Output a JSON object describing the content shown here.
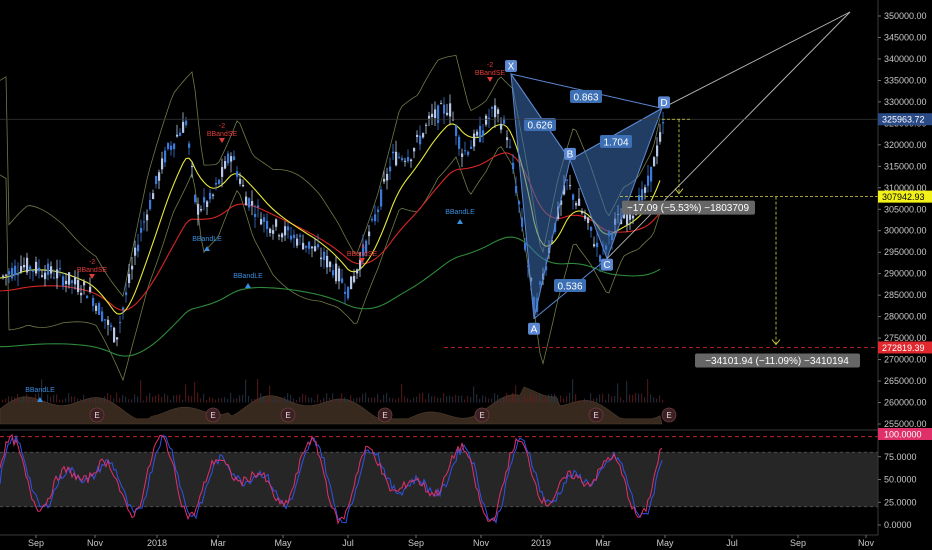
{
  "chart_data": [
    {
      "type": "candlestick",
      "price_ticks": [
        "350000.00",
        "345000.00",
        "340000.00",
        "335000.00",
        "330000.00",
        "325000.00",
        "320000.00",
        "315000.00",
        "310000.00",
        "305000.00",
        "300000.00",
        "295000.00",
        "290000.00",
        "285000.00",
        "280000.00",
        "275000.00",
        "270000.00",
        "265000.00",
        "260000.00",
        "255000.00"
      ],
      "ylim": [
        255000,
        350000
      ],
      "time_ticks": [
        "Sep",
        "Nov",
        "2018",
        "Mar",
        "May",
        "Jul",
        "Sep",
        "Nov",
        "2019",
        "Mar",
        "May",
        "Jul",
        "Sep",
        "Nov"
      ],
      "grid": false,
      "price_labels": [
        {
          "text": "325963.72",
          "value": 325963.72,
          "color": "#2a4a86"
        },
        {
          "text": "307942.93",
          "value": 307942.93,
          "color": "#f2f21a"
        },
        {
          "text": "272819.39",
          "value": 272819.39,
          "color": "#e0282e"
        }
      ],
      "harmonic_pattern": {
        "points": [
          {
            "label": "X",
            "value": 336500
          },
          {
            "label": "A",
            "value": 279500
          },
          {
            "label": "B",
            "value": 316500
          },
          {
            "label": "C",
            "value": 293500
          },
          {
            "label": "D",
            "value": 328500
          }
        ],
        "ratios": [
          "0.863",
          "0.626",
          "1.704",
          "0.536"
        ]
      },
      "measurements": [
        {
          "text": "−17.09 (−5.53%) −1803709",
          "from": 325963.72,
          "to": 307942.93
        },
        {
          "text": "−34101.94 (−11.09%) −3410194",
          "from": 307942.93,
          "to": 272819.39
        }
      ],
      "signals": [
        {
          "text": "BBandSE",
          "count": "-2",
          "kind": "sell"
        },
        {
          "text": "BBandSE",
          "count": "-2",
          "kind": "sell"
        },
        {
          "text": "BBandSE",
          "count": "-2",
          "kind": "sell"
        },
        {
          "text": "BBandSE",
          "count": "-1",
          "kind": "sell"
        },
        {
          "text": "BBandLE",
          "count": "",
          "kind": "buy"
        },
        {
          "text": "BBandLE",
          "count": "",
          "kind": "buy"
        },
        {
          "text": "BBandLE",
          "count": "",
          "kind": "buy"
        },
        {
          "text": "BBandLE",
          "count": "",
          "kind": "buy"
        }
      ],
      "earnings_marker": "E",
      "colors": {
        "up": "#b6c8e6",
        "down": "#3b7ad8",
        "ma_yellow": "#e8e83a",
        "ma_red": "#d82626",
        "ma_green": "#2e8a3a",
        "pattern": "#3d6fb5",
        "stoch_k": "#2a55e8",
        "stoch_d": "#e0306a"
      }
    },
    {
      "type": "line",
      "ticks": [
        "100.0000",
        "75.0000",
        "50.0000",
        "25.0000",
        "0.0000"
      ],
      "ylim": [
        0,
        100
      ],
      "bands": [
        20,
        80
      ]
    }
  ]
}
